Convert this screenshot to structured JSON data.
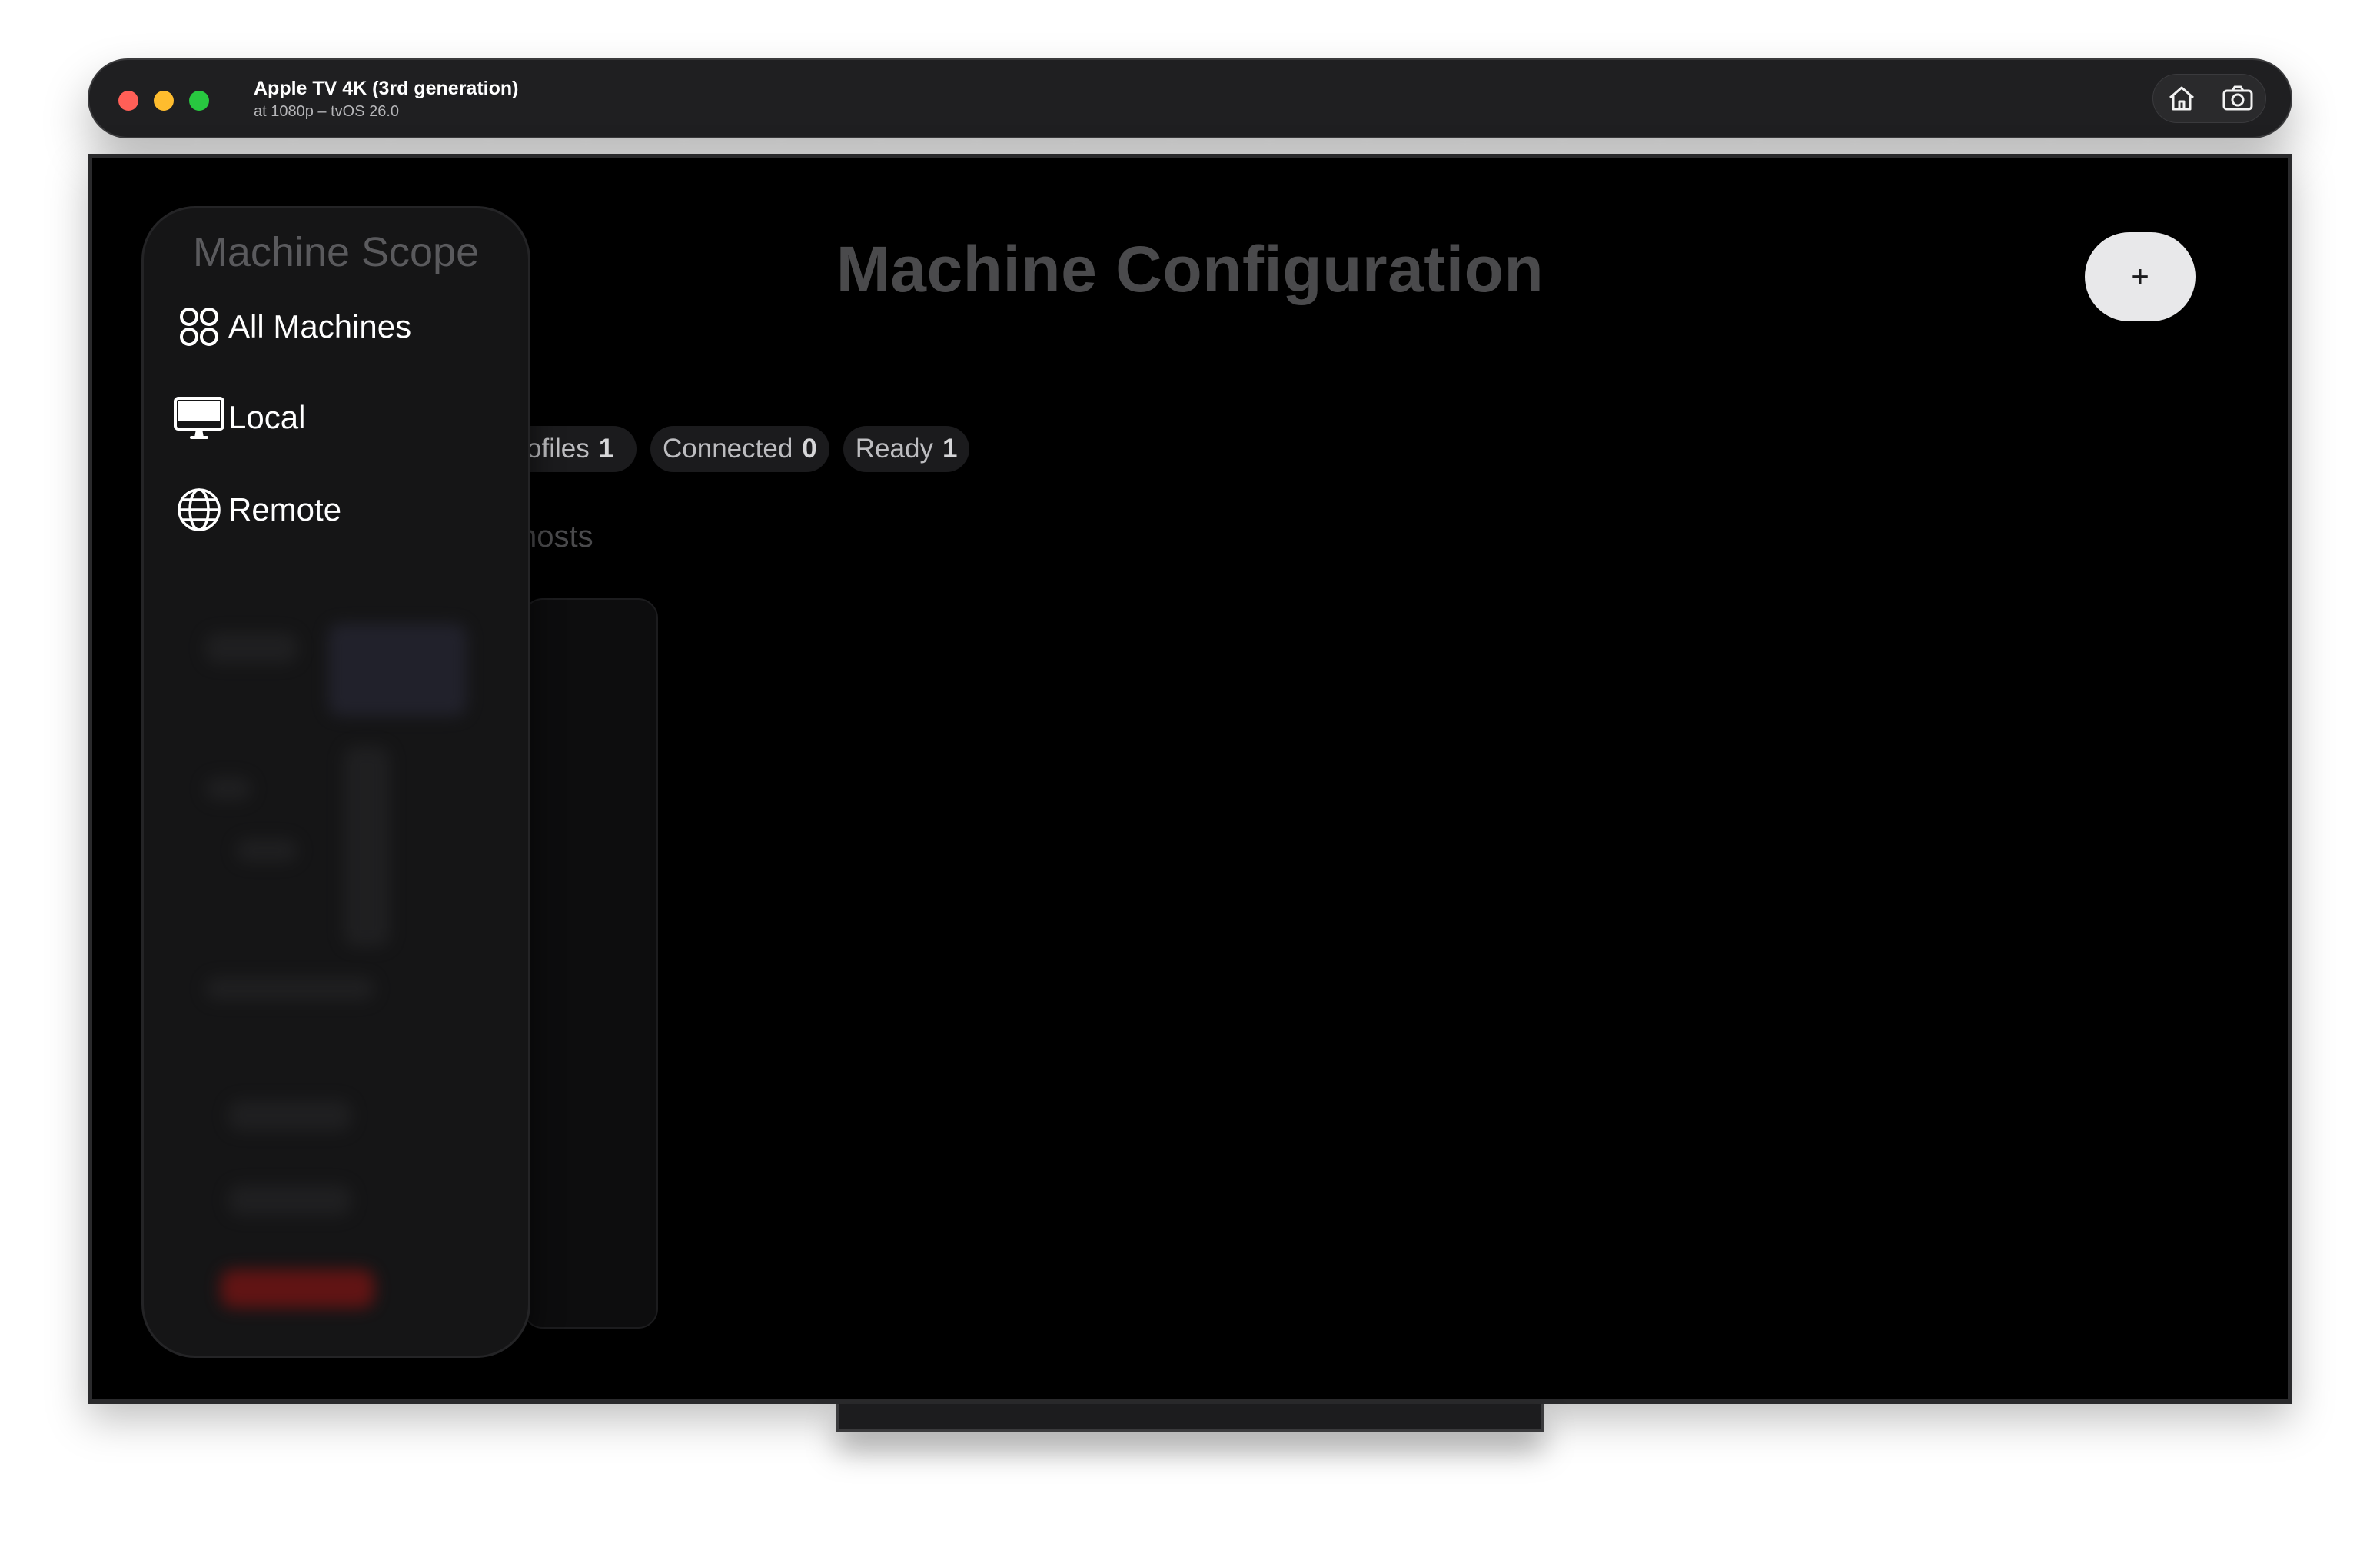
{
  "window": {
    "title": "Apple TV 4K (3rd generation)",
    "subtitle": "at 1080p – tvOS 26.0",
    "buttons": [
      "home-icon",
      "screenshot-icon"
    ]
  },
  "app": {
    "page_title": "Machine Configuration",
    "add_button_label": "+",
    "stats": {
      "profiles_label": "Profiles",
      "profiles_value": "1",
      "connected_label": "Connected",
      "connected_value": "0",
      "ready_label": "Ready",
      "ready_value": "1"
    },
    "hosts_text": "hosts"
  },
  "sidebar": {
    "header": "Machine Scope",
    "items": [
      {
        "label": "All Machines",
        "icon": "grid-icon"
      },
      {
        "label": "Local",
        "icon": "display-icon"
      },
      {
        "label": "Remote",
        "icon": "globe-icon"
      }
    ]
  },
  "colors": {
    "background": "#000000",
    "sidebar": "#151516",
    "title_dimmed": "#4a4a4c",
    "add_button": "#e8e8ea"
  }
}
